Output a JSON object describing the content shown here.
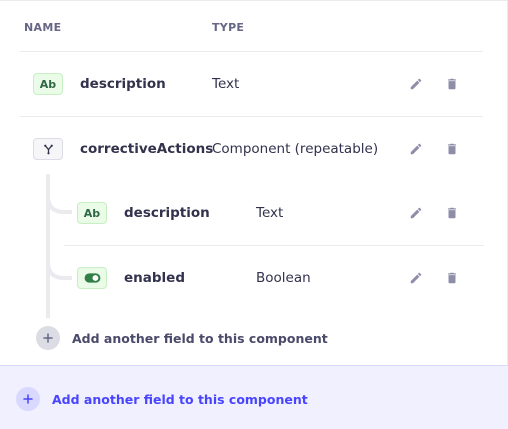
{
  "header": {
    "name_label": "NAME",
    "type_label": "TYPE"
  },
  "fields": [
    {
      "badge": "Ab",
      "name": "description",
      "type": "Text"
    },
    {
      "name": "correctiveActions",
      "type": "Component (repeatable)"
    }
  ],
  "component_fields": [
    {
      "badge": "Ab",
      "name": "description",
      "type": "Text"
    },
    {
      "name": "enabled",
      "type": "Boolean"
    }
  ],
  "add_inner_label": "Add another field to this component",
  "add_outer_label": "Add another field to this component",
  "icons": {
    "edit": "pencil-icon",
    "delete": "trash-icon",
    "component": "component-branch-icon",
    "boolean": "toggle-icon",
    "add": "plus-icon"
  },
  "colors": {
    "accent": "#4945ff",
    "text_badge_bg": "#eafbe7",
    "text_badge_fg": "#2f6846",
    "footer_bg": "#f0f0ff",
    "icon_grey": "#8e8ea9"
  }
}
